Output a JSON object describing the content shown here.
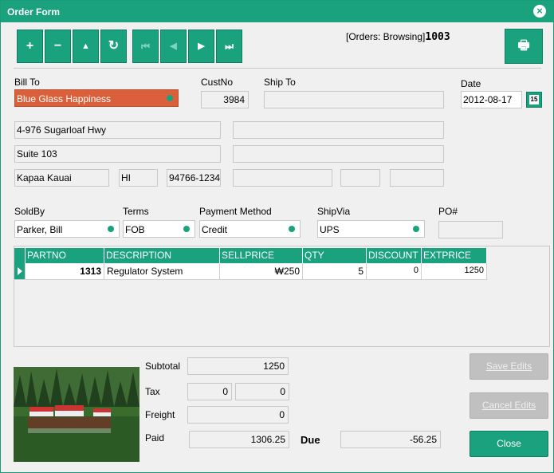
{
  "window": {
    "title": "Order Form"
  },
  "toolbar": {
    "add": "+",
    "remove": "−",
    "up": "▲",
    "refresh": "↻",
    "first": "⏮",
    "prev": "◀",
    "next": "▶",
    "last": "⏭",
    "status_prefix": "[Orders: Browsing]",
    "status_id": "1003",
    "print": "🖶"
  },
  "labels": {
    "bill_to": "Bill To",
    "cust_no": "CustNo",
    "ship_to": "Ship To",
    "date": "Date",
    "sold_by": "SoldBy",
    "terms": "Terms",
    "payment_method": "Payment Method",
    "ship_via": "ShipVia",
    "po": "PO#",
    "subtotal": "Subtotal",
    "tax": "Tax",
    "freight": "Freight",
    "paid": "Paid",
    "due": "Due"
  },
  "bill": {
    "name": "Blue Glass Happiness",
    "cust_no": "3984",
    "addr1": "4-976 Sugarloaf Hwy",
    "addr2": "Suite 103",
    "city": "Kapaa Kauai",
    "state": "HI",
    "zip": "94766-1234"
  },
  "ship": {
    "name": "",
    "addr1": "",
    "addr2": "",
    "city": "",
    "state": "",
    "zip": ""
  },
  "date": {
    "value": "2012-08-17",
    "icon": "15"
  },
  "order": {
    "sold_by": "Parker, Bill",
    "terms": "FOB",
    "payment_method": "Credit",
    "ship_via": "UPS",
    "po": ""
  },
  "grid": {
    "headers": [
      "PARTNO",
      "DESCRIPTION",
      "SELLPRICE",
      "QTY",
      "DISCOUNT",
      "EXTPRICE"
    ],
    "rows": [
      {
        "partno": "1313",
        "description": "Regulator System",
        "sellprice": "₩250",
        "qty": "5",
        "discount": "0",
        "extprice": "1250"
      }
    ]
  },
  "totals": {
    "subtotal": "1250",
    "tax_rate": "0",
    "tax": "0",
    "freight": "0",
    "paid": "1306.25",
    "due": "-56.25"
  },
  "buttons": {
    "save": "Save Edits",
    "cancel": "Cancel Edits",
    "close": "Close"
  },
  "colors": {
    "accent": "#1aa27f",
    "billto_highlight": "#d9603b"
  }
}
